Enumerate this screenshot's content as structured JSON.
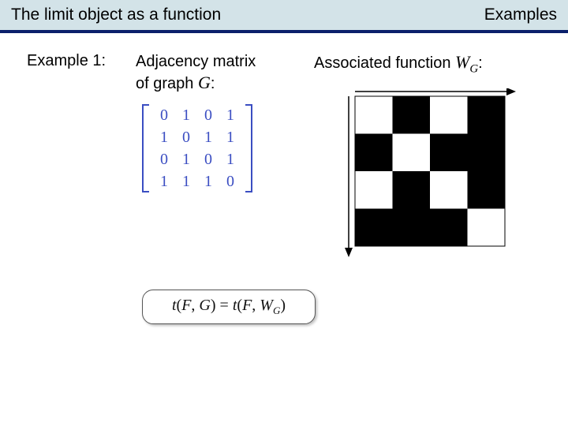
{
  "titlebar": {
    "left": "The limit object as a function",
    "right": "Examples"
  },
  "example_label": "Example 1:",
  "adjacency": {
    "line1": "Adjacency matrix",
    "line2_prefix": "of graph ",
    "graph_symbol": "G",
    "line2_suffix": ":",
    "matrix": [
      [
        0,
        1,
        0,
        1
      ],
      [
        1,
        0,
        1,
        1
      ],
      [
        0,
        1,
        0,
        1
      ],
      [
        1,
        1,
        1,
        0
      ]
    ]
  },
  "associated": {
    "prefix": "Associated function ",
    "symbol_W": "W",
    "symbol_sub": "G",
    "suffix": ":"
  },
  "formula": {
    "t": "t",
    "lp": "(",
    "F": "F",
    "comma": ", ",
    "G": "G",
    "rp": ")",
    "eq": " = ",
    "W": "W",
    "Wsub": "G"
  },
  "colors": {
    "titlebar_bg": "#d3e3e8",
    "titlebar_border": "#0a1f6b",
    "matrix_color": "#3b4ec2"
  },
  "chart_data": {
    "type": "heatmap",
    "title": "Associated function W_G",
    "grid_size": 4,
    "values": [
      [
        0,
        1,
        0,
        1
      ],
      [
        1,
        0,
        1,
        1
      ],
      [
        0,
        1,
        0,
        1
      ],
      [
        1,
        1,
        1,
        0
      ]
    ],
    "value_colors": {
      "0": "#ffffff",
      "1": "#000000"
    },
    "axes": {
      "x_arrow": "right",
      "y_arrow": "down"
    }
  }
}
